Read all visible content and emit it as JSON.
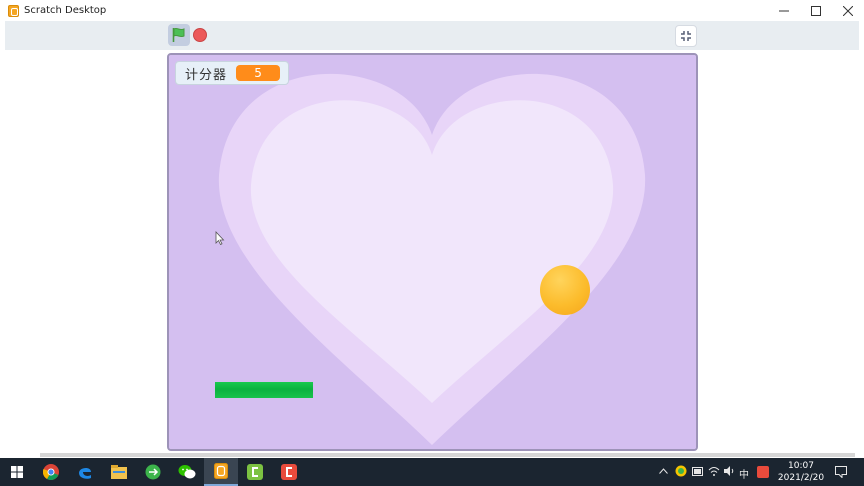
{
  "window": {
    "title": "Scratch Desktop",
    "controls": [
      "minimize",
      "maximize",
      "close"
    ]
  },
  "toolbar": {
    "green_flag": "green-flag-icon",
    "stop": "stop-icon",
    "unfullscreen": "unfullscreen-icon"
  },
  "stage": {
    "monitor": {
      "label": "计分器",
      "value": "5"
    },
    "colors": {
      "background": "#d4bff0",
      "heart_outer": "#e8d5f8",
      "heart_inner": "#f1e6fb",
      "ball": "#fcbc2c",
      "paddle": "#0bb23f"
    }
  },
  "taskbar": {
    "apps": [
      "start-icon",
      "chrome-icon",
      "edge-icon",
      "file-explorer-icon",
      "green-app-icon",
      "wechat-icon",
      "scratch-icon",
      "camtasia-icon",
      "red-app-icon"
    ],
    "tray": {
      "ime": "中",
      "time": "10:07",
      "date": "2021/2/20"
    }
  }
}
